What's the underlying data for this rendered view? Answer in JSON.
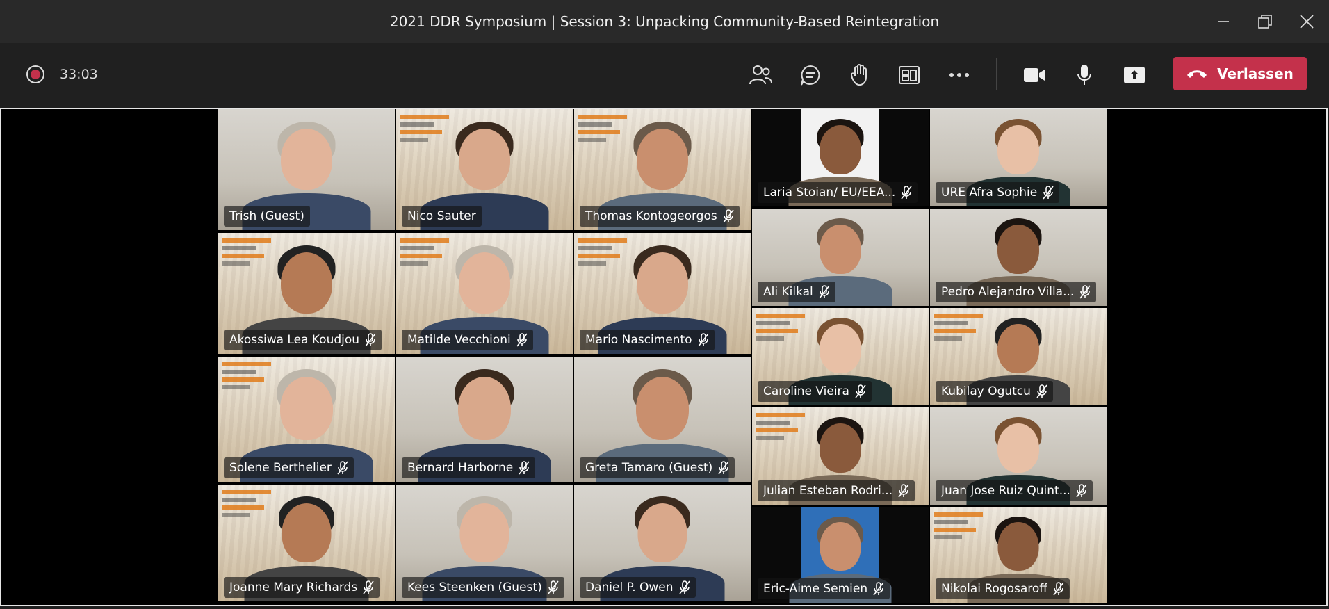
{
  "window": {
    "title": "2021 DDR Symposium | Session 3: Unpacking Community-Based Reintegration"
  },
  "toolbar": {
    "timer": "33:03",
    "leave_label": "Verlassen",
    "icons": [
      "people-icon",
      "chat-icon",
      "raise-hand-icon",
      "rooms-icon",
      "more-icon",
      "camera-icon",
      "mic-icon",
      "share-icon"
    ]
  },
  "colors": {
    "leave": "#c4314b",
    "background": "#202020"
  },
  "participants": [
    {
      "name": "Trish (Guest)",
      "muted": false
    },
    {
      "name": "Nico Sauter",
      "muted": false
    },
    {
      "name": "Thomas Kontogeorgos",
      "muted": true
    },
    {
      "name": "Laria Stoian/ EU/EEA...",
      "muted": true
    },
    {
      "name": "URE Afra Sophie",
      "muted": true
    },
    {
      "name": "Akossiwa Lea Koudjou",
      "muted": true
    },
    {
      "name": "Matilde Vecchioni",
      "muted": true
    },
    {
      "name": "Mario Nascimento",
      "muted": true
    },
    {
      "name": "Ali Kilkal",
      "muted": true
    },
    {
      "name": "Pedro Alejandro Villa...",
      "muted": true
    },
    {
      "name": "Caroline Vieira",
      "muted": true
    },
    {
      "name": "Kubilay Ogutcu",
      "muted": true
    },
    {
      "name": "Solene Berthelier",
      "muted": true
    },
    {
      "name": "Bernard Harborne",
      "muted": true
    },
    {
      "name": "Greta Tamaro (Guest)",
      "muted": true
    },
    {
      "name": "Julian Esteban Rodri...",
      "muted": true
    },
    {
      "name": "Juan Jose Ruiz Quint...",
      "muted": true
    },
    {
      "name": "Joanne Mary Richards",
      "muted": true
    },
    {
      "name": "Kees Steenken (Guest)",
      "muted": true
    },
    {
      "name": "Daniel P. Owen",
      "muted": true
    },
    {
      "name": "Eric-Aime Semien",
      "muted": true
    },
    {
      "name": "Nikolai Rogosaroff",
      "muted": true
    }
  ]
}
